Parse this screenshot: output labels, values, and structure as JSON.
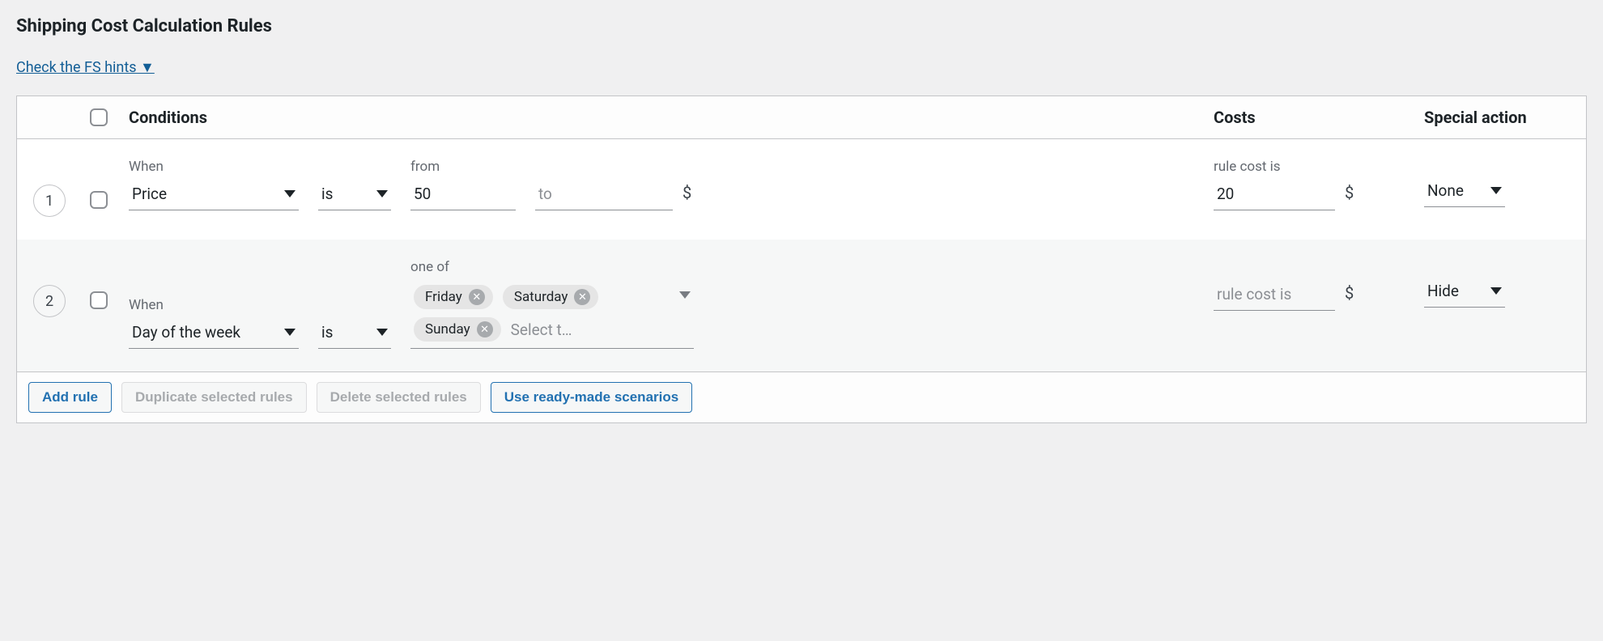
{
  "page_title": "Shipping Cost Calculation Rules",
  "hints_link": "Check the FS hints ▼",
  "columns": {
    "conditions": "Conditions",
    "costs": "Costs",
    "special_action": "Special action"
  },
  "labels": {
    "when": "When",
    "from": "from",
    "to": "to",
    "one_of": "one of",
    "rule_cost_is": "rule cost is",
    "currency": "$",
    "select_placeholder": "Select t…"
  },
  "rules": [
    {
      "index": "1",
      "when": "Price",
      "operator": "is",
      "from_value": "50",
      "to_value": "",
      "cost_value": "20",
      "cost_placeholder": "",
      "action": "None",
      "type": "range"
    },
    {
      "index": "2",
      "when": "Day of the week",
      "operator": "is",
      "tags": [
        "Friday",
        "Saturday",
        "Sunday"
      ],
      "cost_value": "",
      "cost_placeholder": "rule cost is",
      "action": "Hide",
      "type": "tags"
    }
  ],
  "buttons": {
    "add_rule": "Add rule",
    "duplicate": "Duplicate selected rules",
    "delete": "Delete selected rules",
    "scenarios": "Use ready-made scenarios"
  }
}
